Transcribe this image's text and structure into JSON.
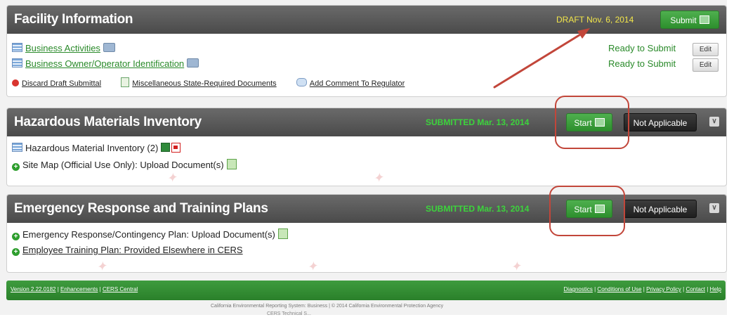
{
  "facility": {
    "title": "Facility Information",
    "status": "DRAFT Nov. 6, 2014",
    "submit_label": "Submit",
    "items": [
      {
        "label": "Business Activities",
        "status": "Ready to Submit",
        "edit": "Edit"
      },
      {
        "label": "Business Owner/Operator Identification",
        "status": "Ready to Submit",
        "edit": "Edit"
      }
    ],
    "actions": {
      "discard": "Discard Draft Submittal",
      "misc": "Miscellaneous State-Required Documents",
      "comment": "Add Comment To Regulator"
    }
  },
  "hazmat": {
    "title": "Hazardous Materials Inventory",
    "status": "SUBMITTED Mar. 13, 2014",
    "start_label": "Start",
    "na_label": "Not Applicable",
    "items": {
      "inventory": "Hazardous Material Inventory (2)",
      "sitemap": "Site Map (Official Use Only): Upload Document(s)"
    }
  },
  "emergency": {
    "title": "Emergency Response and Training Plans",
    "status": "SUBMITTED Mar. 13, 2014",
    "start_label": "Start",
    "na_label": "Not Applicable",
    "items": {
      "plan": "Emergency Response/Contingency Plan: Upload Document(s)",
      "training": "Employee Training Plan: Provided Elsewhere in CERS"
    }
  },
  "footer": {
    "version": "Version 2.22.0182",
    "enhancements": "Enhancements",
    "central": "CERS Central",
    "diagnostics": "Diagnostics",
    "conditions": "Conditions of Use",
    "privacy": "Privacy Policy",
    "contact": "Contact",
    "help": "Help",
    "copyright": "California Environmental Reporting System: Business | © 2014 California Environmental Protection Agency",
    "sub": "CERS Technical S..."
  },
  "colors": {
    "accent_green": "#2d8f2d",
    "draft_yellow": "#f2e64a",
    "submitted_green": "#3cd43c",
    "highlight_red": "#c2463a"
  }
}
